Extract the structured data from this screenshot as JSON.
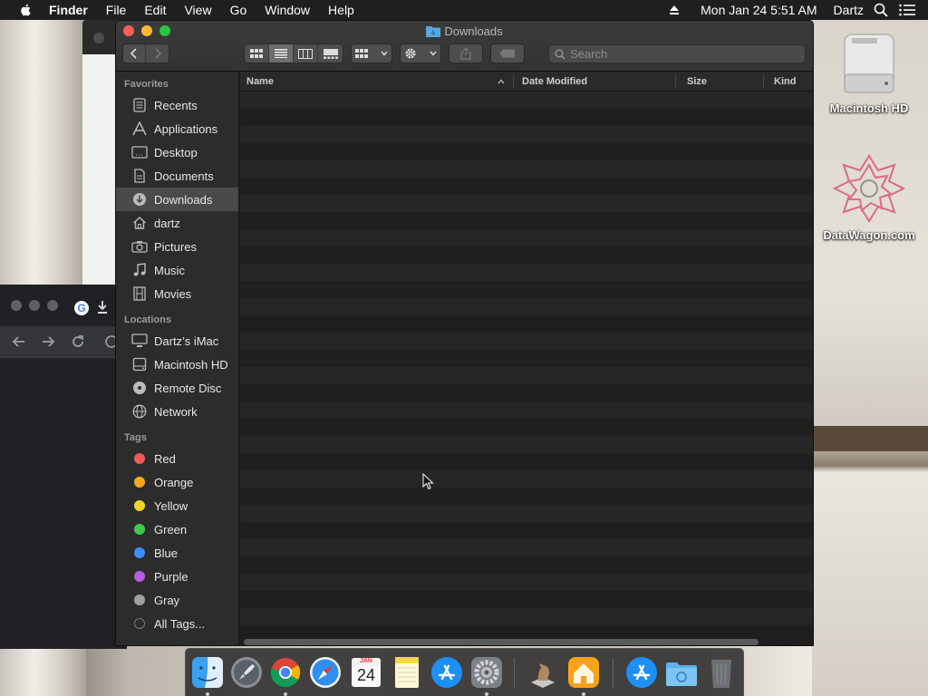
{
  "menubar": {
    "app_name": "Finder",
    "menus": [
      "File",
      "Edit",
      "View",
      "Go",
      "Window",
      "Help"
    ],
    "datetime": "Mon Jan 24  5:51 AM",
    "user": "Dartz"
  },
  "finder": {
    "title": "Downloads",
    "search_placeholder": "Search",
    "columns": {
      "name": "Name",
      "date_modified": "Date Modified",
      "size": "Size",
      "kind": "Kind"
    },
    "sidebar": {
      "favorites_header": "Favorites",
      "favorites": [
        "Recents",
        "Applications",
        "Desktop",
        "Documents",
        "Downloads",
        "dartz",
        "Pictures",
        "Music",
        "Movies"
      ],
      "selected": "Downloads",
      "locations_header": "Locations",
      "locations": [
        "Dartz’s iMac",
        "Macintosh HD",
        "Remote Disc",
        "Network"
      ],
      "tags_header": "Tags",
      "tags": [
        {
          "label": "Red",
          "color": "#ec5b57"
        },
        {
          "label": "Orange",
          "color": "#f5a623"
        },
        {
          "label": "Yellow",
          "color": "#f2d42b"
        },
        {
          "label": "Green",
          "color": "#44c84b"
        },
        {
          "label": "Blue",
          "color": "#3a8ff4"
        },
        {
          "label": "Purple",
          "color": "#b85ce0"
        },
        {
          "label": "Gray",
          "color": "#a0a0a0"
        }
      ],
      "all_tags": "All Tags..."
    }
  },
  "desktop": {
    "icons": [
      "Macintosh HD",
      "DataWagon.com"
    ]
  },
  "chrome": {
    "favicon_letter": "G"
  },
  "dock": {
    "calendar_month": "JAN",
    "calendar_day": "24",
    "apps": [
      "Finder",
      "Launchpad",
      "Google Chrome",
      "Safari",
      "Calendar",
      "Notes",
      "App Store",
      "System Preferences",
      "Chess",
      "Home",
      "App Store Installer",
      "Downloads Folder",
      "Trash"
    ]
  }
}
